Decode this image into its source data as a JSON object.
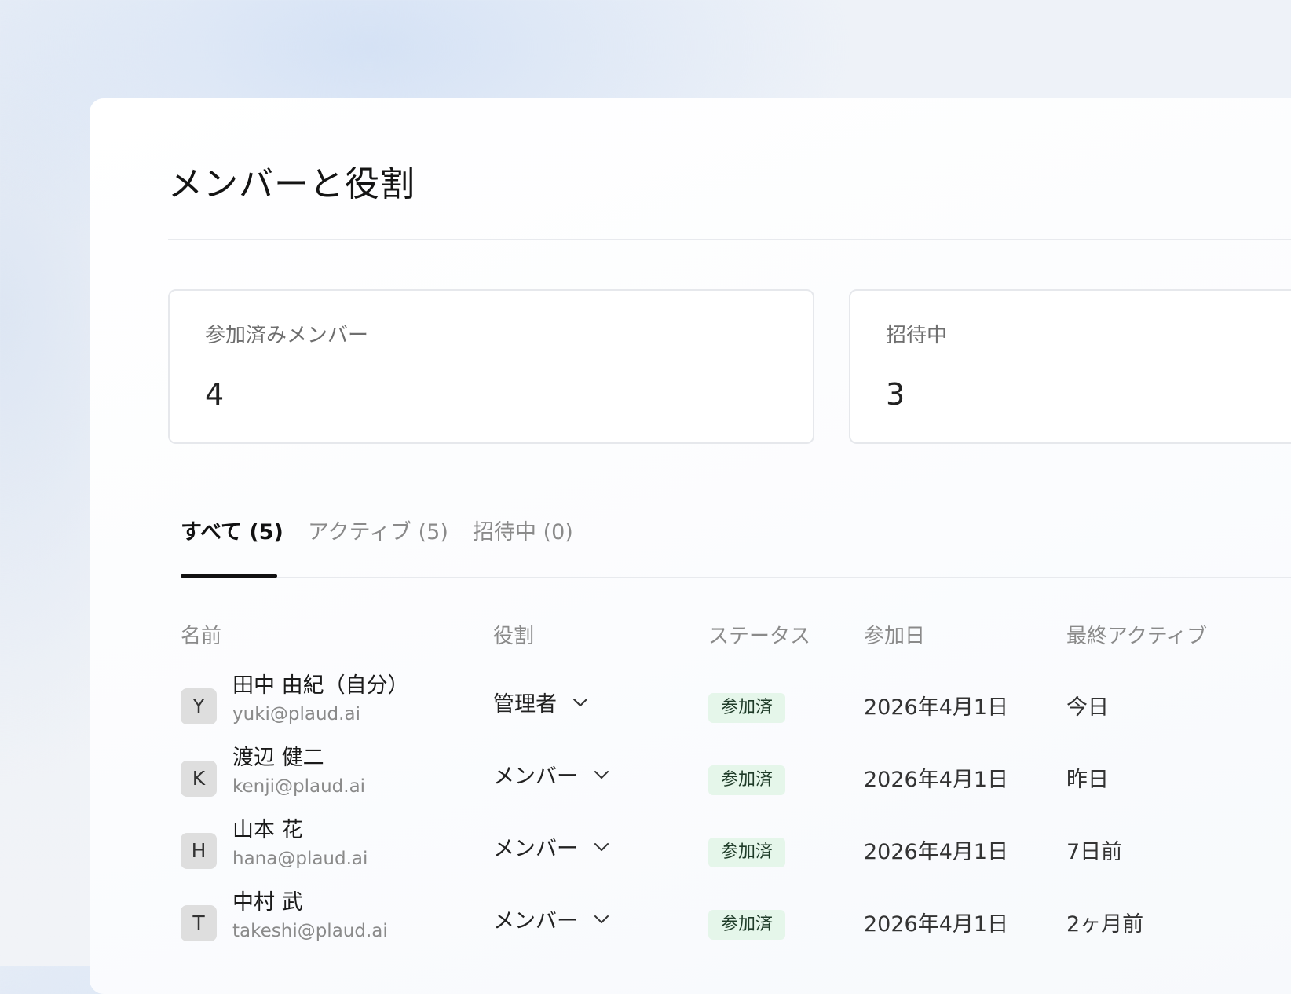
{
  "page": {
    "title": "メンバーと役割"
  },
  "stats": {
    "joined": {
      "label": "参加済みメンバー",
      "value": "4"
    },
    "invited": {
      "label": "招待中",
      "value": "3"
    }
  },
  "tabs": [
    {
      "label": "すべて (5)",
      "active": true
    },
    {
      "label": "アクティブ (5)",
      "active": false
    },
    {
      "label": "招待中 (0)",
      "active": false
    }
  ],
  "table": {
    "headers": {
      "name": "名前",
      "role": "役割",
      "status": "ステータス",
      "joined": "参加日",
      "last_active": "最終アクティブ"
    },
    "rows": [
      {
        "initial": "Y",
        "name": "田中 由紀（自分）",
        "email": "yuki@plaud.ai",
        "role": "管理者",
        "status": "参加済",
        "joined": "2026年4月1日",
        "last_active": "今日"
      },
      {
        "initial": "K",
        "name": "渡辺 健二",
        "email": "kenji@plaud.ai",
        "role": "メンバー",
        "status": "参加済",
        "joined": "2026年4月1日",
        "last_active": "昨日"
      },
      {
        "initial": "H",
        "name": "山本 花",
        "email": "hana@plaud.ai",
        "role": "メンバー",
        "status": "参加済",
        "joined": "2026年4月1日",
        "last_active": "7日前"
      },
      {
        "initial": "T",
        "name": "中村 武",
        "email": "takeshi@plaud.ai",
        "role": "メンバー",
        "status": "参加済",
        "joined": "2026年4月1日",
        "last_active": "2ヶ月前"
      }
    ]
  },
  "icons": {
    "role_dropdown": "chevron-down-icon"
  },
  "colors": {
    "status_badge_bg": "#e5f6ea",
    "active_tab": "#111111",
    "muted_text": "#8a8a8a"
  }
}
